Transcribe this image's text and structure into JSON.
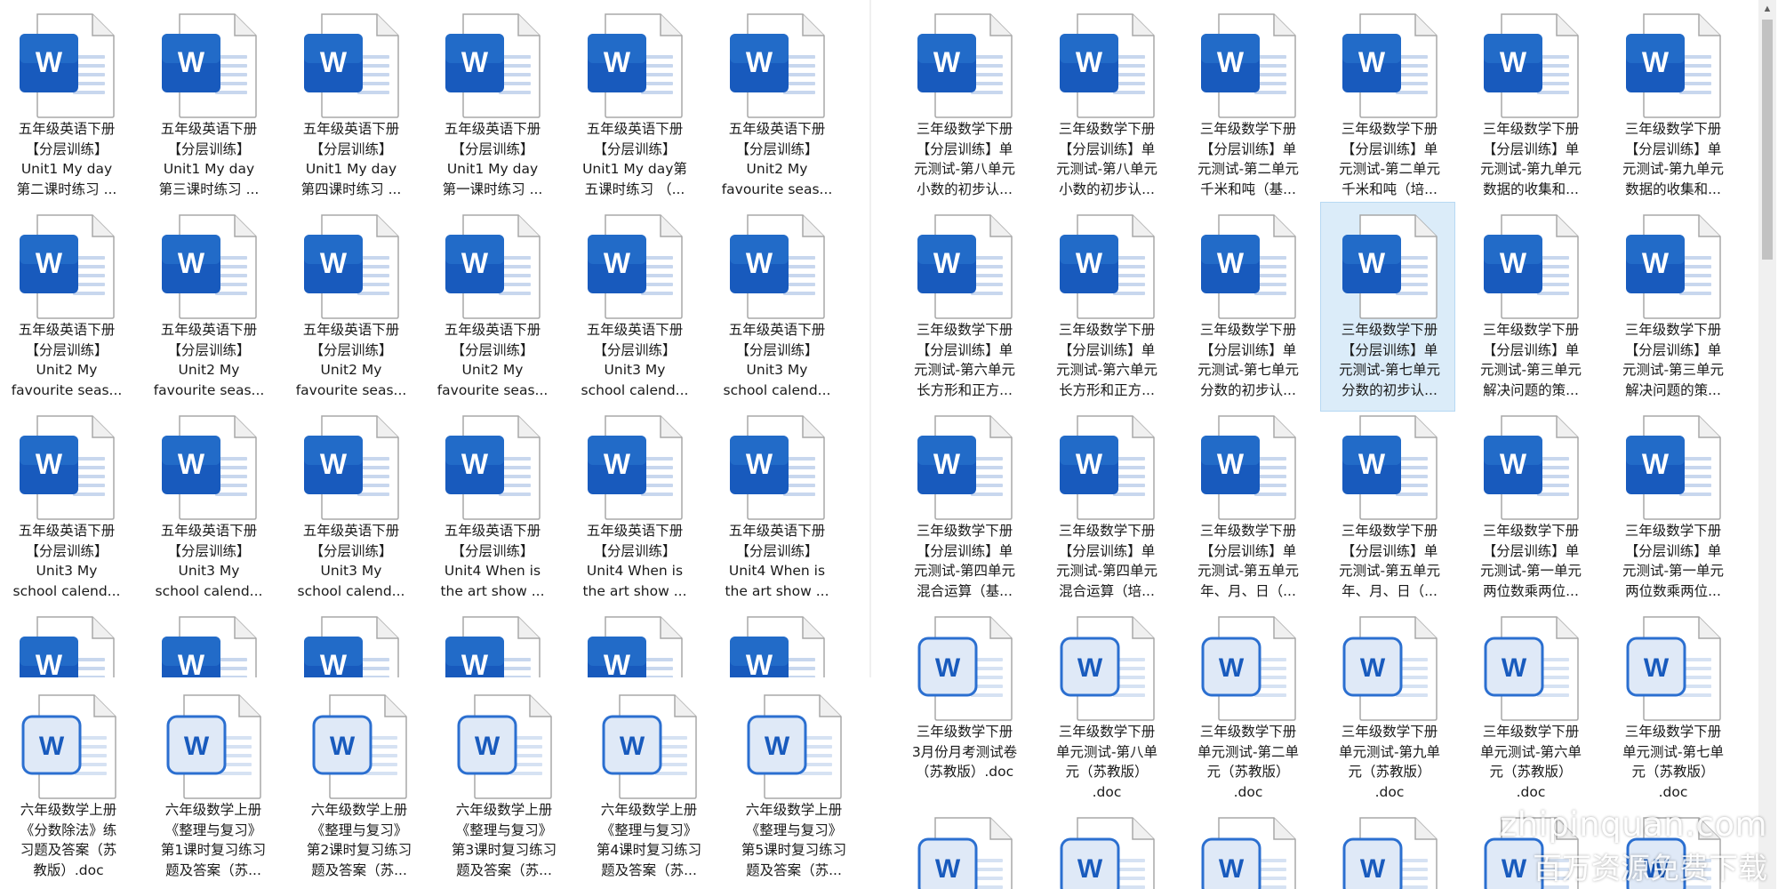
{
  "watermark": {
    "site": "zhipinquan.com",
    "tagline": "百万资源免费下载"
  },
  "icons": {
    "word_letter": "W",
    "word_color": "#185abd"
  },
  "left_pane": {
    "english_files": [
      [
        "五年级英语下册",
        "【分层训练】",
        "Unit1 My day",
        "第二课时练习 ..."
      ],
      [
        "五年级英语下册",
        "【分层训练】",
        "Unit1 My day",
        "第三课时练习 ..."
      ],
      [
        "五年级英语下册",
        "【分层训练】",
        "Unit1 My day",
        "第四课时练习 ..."
      ],
      [
        "五年级英语下册",
        "【分层训练】",
        "Unit1 My day",
        "第一课时练习 ..."
      ],
      [
        "五年级英语下册",
        "【分层训练】",
        "Unit1 My day第",
        "五课时练习 （..."
      ],
      [
        "五年级英语下册",
        "【分层训练】",
        "Unit2 My",
        "favourite seas..."
      ],
      [
        "五年级英语下册",
        "【分层训练】",
        "Unit2 My",
        "favourite seas..."
      ],
      [
        "五年级英语下册",
        "【分层训练】",
        "Unit2 My",
        "favourite seas..."
      ],
      [
        "五年级英语下册",
        "【分层训练】",
        "Unit2 My",
        "favourite seas..."
      ],
      [
        "五年级英语下册",
        "【分层训练】",
        "Unit2 My",
        "favourite seas..."
      ],
      [
        "五年级英语下册",
        "【分层训练】",
        "Unit3 My",
        "school calend..."
      ],
      [
        "五年级英语下册",
        "【分层训练】",
        "Unit3 My",
        "school calend..."
      ],
      [
        "五年级英语下册",
        "【分层训练】",
        "Unit3 My",
        "school calend..."
      ],
      [
        "五年级英语下册",
        "【分层训练】",
        "Unit3 My",
        "school calend..."
      ],
      [
        "五年级英语下册",
        "【分层训练】",
        "Unit3 My",
        "school calend..."
      ],
      [
        "五年级英语下册",
        "【分层训练】",
        "Unit4 When is",
        "the art show ..."
      ],
      [
        "五年级英语下册",
        "【分层训练】",
        "Unit4 When is",
        "the art show ..."
      ],
      [
        "五年级英语下册",
        "【分层训练】",
        "Unit4 When is",
        "the art show ..."
      ]
    ],
    "math_files": [
      [
        "六年级数学上册",
        "《分数除法》练",
        "习题及答案（苏",
        "教版）.doc"
      ],
      [
        "六年级数学上册",
        "《整理与复习》",
        "第1课时复习练习",
        "题及答案（苏..."
      ],
      [
        "六年级数学上册",
        "《整理与复习》",
        "第2课时复习练习",
        "题及答案（苏..."
      ],
      [
        "六年级数学上册",
        "《整理与复习》",
        "第3课时复习练习",
        "题及答案（苏..."
      ],
      [
        "六年级数学上册",
        "《整理与复习》",
        "第4课时复习练习",
        "题及答案（苏..."
      ],
      [
        "六年级数学上册",
        "《整理与复习》",
        "第5课时复习练习",
        "题及答案（苏..."
      ]
    ]
  },
  "right_pane": {
    "files": [
      [
        "三年级数学下册",
        "【分层训练】单",
        "元测试-第八单元",
        "小数的初步认..."
      ],
      [
        "三年级数学下册",
        "【分层训练】单",
        "元测试-第八单元",
        "小数的初步认..."
      ],
      [
        "三年级数学下册",
        "【分层训练】单",
        "元测试-第二单元",
        "千米和吨（基..."
      ],
      [
        "三年级数学下册",
        "【分层训练】单",
        "元测试-第二单元",
        "千米和吨（培..."
      ],
      [
        "三年级数学下册",
        "【分层训练】单",
        "元测试-第九单元",
        "数据的收集和..."
      ],
      [
        "三年级数学下册",
        "【分层训练】单",
        "元测试-第九单元",
        "数据的收集和..."
      ],
      [
        "三年级数学下册",
        "【分层训练】单",
        "元测试-第六单元",
        "长方形和正方..."
      ],
      [
        "三年级数学下册",
        "【分层训练】单",
        "元测试-第六单元",
        "长方形和正方..."
      ],
      [
        "三年级数学下册",
        "【分层训练】单",
        "元测试-第七单元",
        "分数的初步认..."
      ],
      [
        "三年级数学下册",
        "【分层训练】单",
        "元测试-第七单元",
        "分数的初步认..."
      ],
      [
        "三年级数学下册",
        "【分层训练】单",
        "元测试-第三单元",
        "解决问题的策..."
      ],
      [
        "三年级数学下册",
        "【分层训练】单",
        "元测试-第三单元",
        "解决问题的策..."
      ],
      [
        "三年级数学下册",
        "【分层训练】单",
        "元测试-第四单元",
        "混合运算（基..."
      ],
      [
        "三年级数学下册",
        "【分层训练】单",
        "元测试-第四单元",
        "混合运算（培..."
      ],
      [
        "三年级数学下册",
        "【分层训练】单",
        "元测试-第五单元",
        "年、月、日（..."
      ],
      [
        "三年级数学下册",
        "【分层训练】单",
        "元测试-第五单元",
        "年、月、日（..."
      ],
      [
        "三年级数学下册",
        "【分层训练】单",
        "元测试-第一单元",
        "两位数乘两位..."
      ],
      [
        "三年级数学下册",
        "【分层训练】单",
        "元测试-第一单元",
        "两位数乘两位..."
      ],
      [
        "三年级数学下册",
        "3月份月考测试卷",
        "（苏教版）.doc"
      ],
      [
        "三年级数学下册",
        "单元测试-第八单",
        "元（苏教版）",
        ".doc"
      ],
      [
        "三年级数学下册",
        "单元测试-第二单",
        "元（苏教版）",
        ".doc"
      ],
      [
        "三年级数学下册",
        "单元测试-第九单",
        "元（苏教版）",
        ".doc"
      ],
      [
        "三年级数学下册",
        "单元测试-第六单",
        "元（苏教版）",
        ".doc"
      ],
      [
        "三年级数学下册",
        "单元测试-第七单",
        "元（苏教版）",
        ".doc"
      ],
      [],
      [],
      [],
      [],
      [],
      []
    ],
    "selected_index": 9
  }
}
